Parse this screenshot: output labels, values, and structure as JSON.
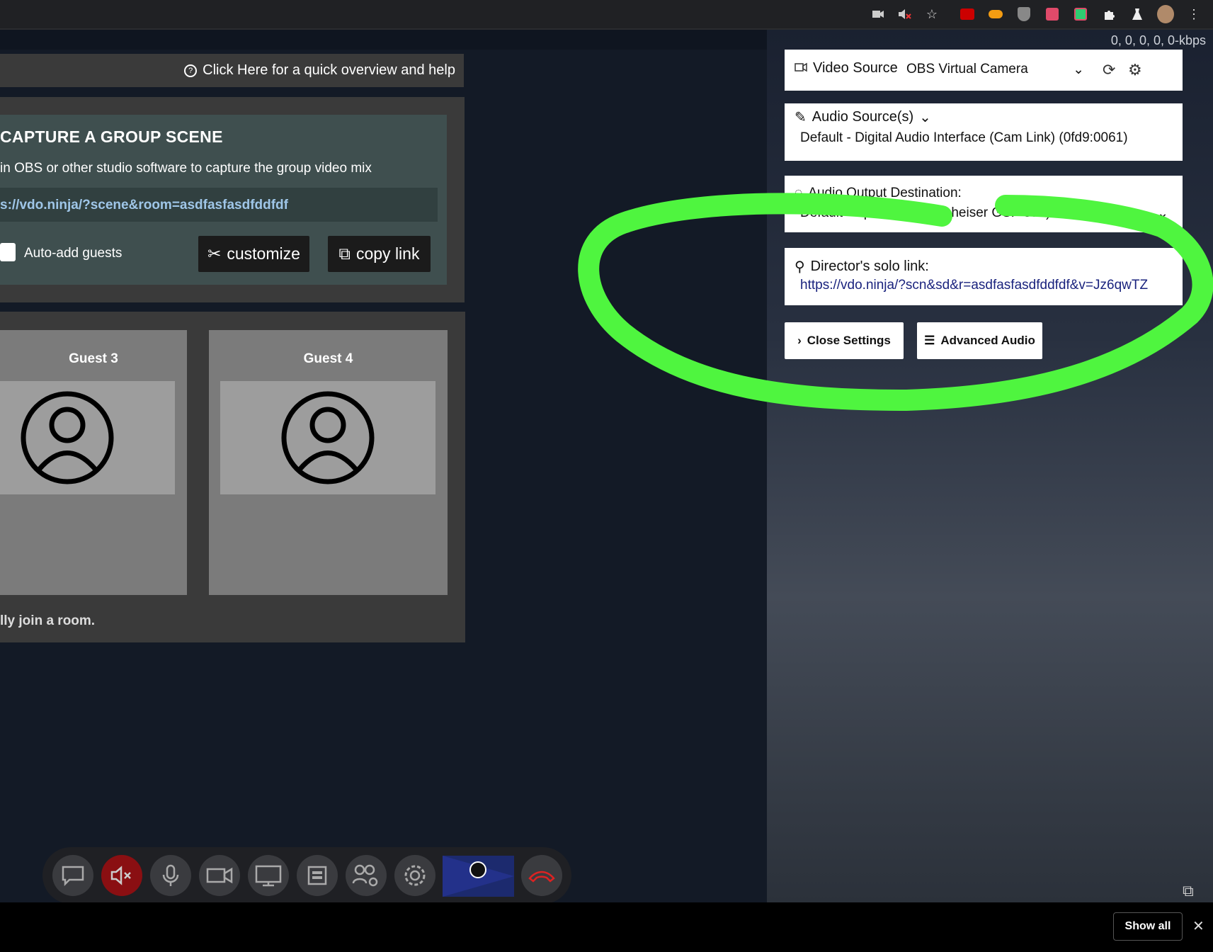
{
  "stats": {
    "text": "0,  0,  0,  0,  0-kbps"
  },
  "help": {
    "label": "Click Here for a quick overview and help"
  },
  "scene": {
    "title": "CAPTURE A GROUP SCENE",
    "description": "in OBS or other studio software to capture the group video mix",
    "link": "s://vdo.ninja/?scene&room=asdfasfasdfddfdf",
    "auto_add_label": "Auto-add guests",
    "customize_label": "customize",
    "copy_link_label": "copy link"
  },
  "guests": [
    {
      "name": "Guest 3"
    },
    {
      "name": "Guest 4"
    }
  ],
  "join_text": "lly join a room.",
  "settings": {
    "video_source_label": "Video Source",
    "video_source_value": "OBS Virtual Camera",
    "audio_source_label": "Audio Source(s)",
    "audio_source_value": "Default - Digital Audio Interface (Cam Link) (0fd9:0061)",
    "audio_output_label": "Audio Output Destination:",
    "audio_output_value": "Default - Speakers (Sennheiser GSP 370)",
    "director_label": "Director's solo link:",
    "director_link": "https://vdo.ninja/?scn&sd&r=asdfasfasdfddfdf&v=Jz6qwTZ",
    "close_settings_label": "Close Settings",
    "advanced_audio_label": "Advanced Audio"
  },
  "downloads": {
    "show_all_label": "Show all"
  },
  "colors": {
    "annotation": "#4ff53f",
    "hangup": "#d22",
    "mute_active": "#8a0f12"
  },
  "icons": [
    "camera-icon",
    "speaker-muted-icon",
    "star-icon",
    "extension-icons",
    "puzzle-icon",
    "labs-icon",
    "profile-avatar",
    "menu-icon",
    "chat-icon",
    "mute-speaker-icon",
    "mic-icon",
    "video-icon",
    "screenshare-icon",
    "window-share-icon",
    "room-settings-icon",
    "gear-icon",
    "obs-preview",
    "hangup-icon"
  ]
}
